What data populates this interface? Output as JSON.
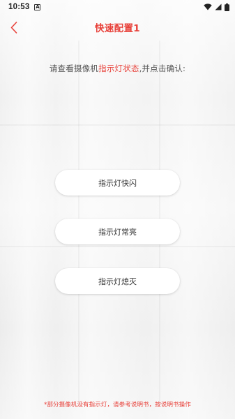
{
  "status_bar": {
    "time": "10:53",
    "notification_letter": "A"
  },
  "header": {
    "title": "快速配置1",
    "back_icon": "chevron-left-icon"
  },
  "instruction": {
    "prefix": "请查看摄像机",
    "highlight": "指示灯状态",
    "suffix": ",并点击确认:"
  },
  "options": [
    {
      "label": "指示灯快闪"
    },
    {
      "label": "指示灯常亮"
    },
    {
      "label": "指示灯熄灭"
    }
  ],
  "footer_note": "*部分摄像机没有指示灯，请参考说明书，按说明书操作",
  "colors": {
    "accent": "#e8413a",
    "text": "#555555",
    "button_bg": "#ffffff"
  }
}
